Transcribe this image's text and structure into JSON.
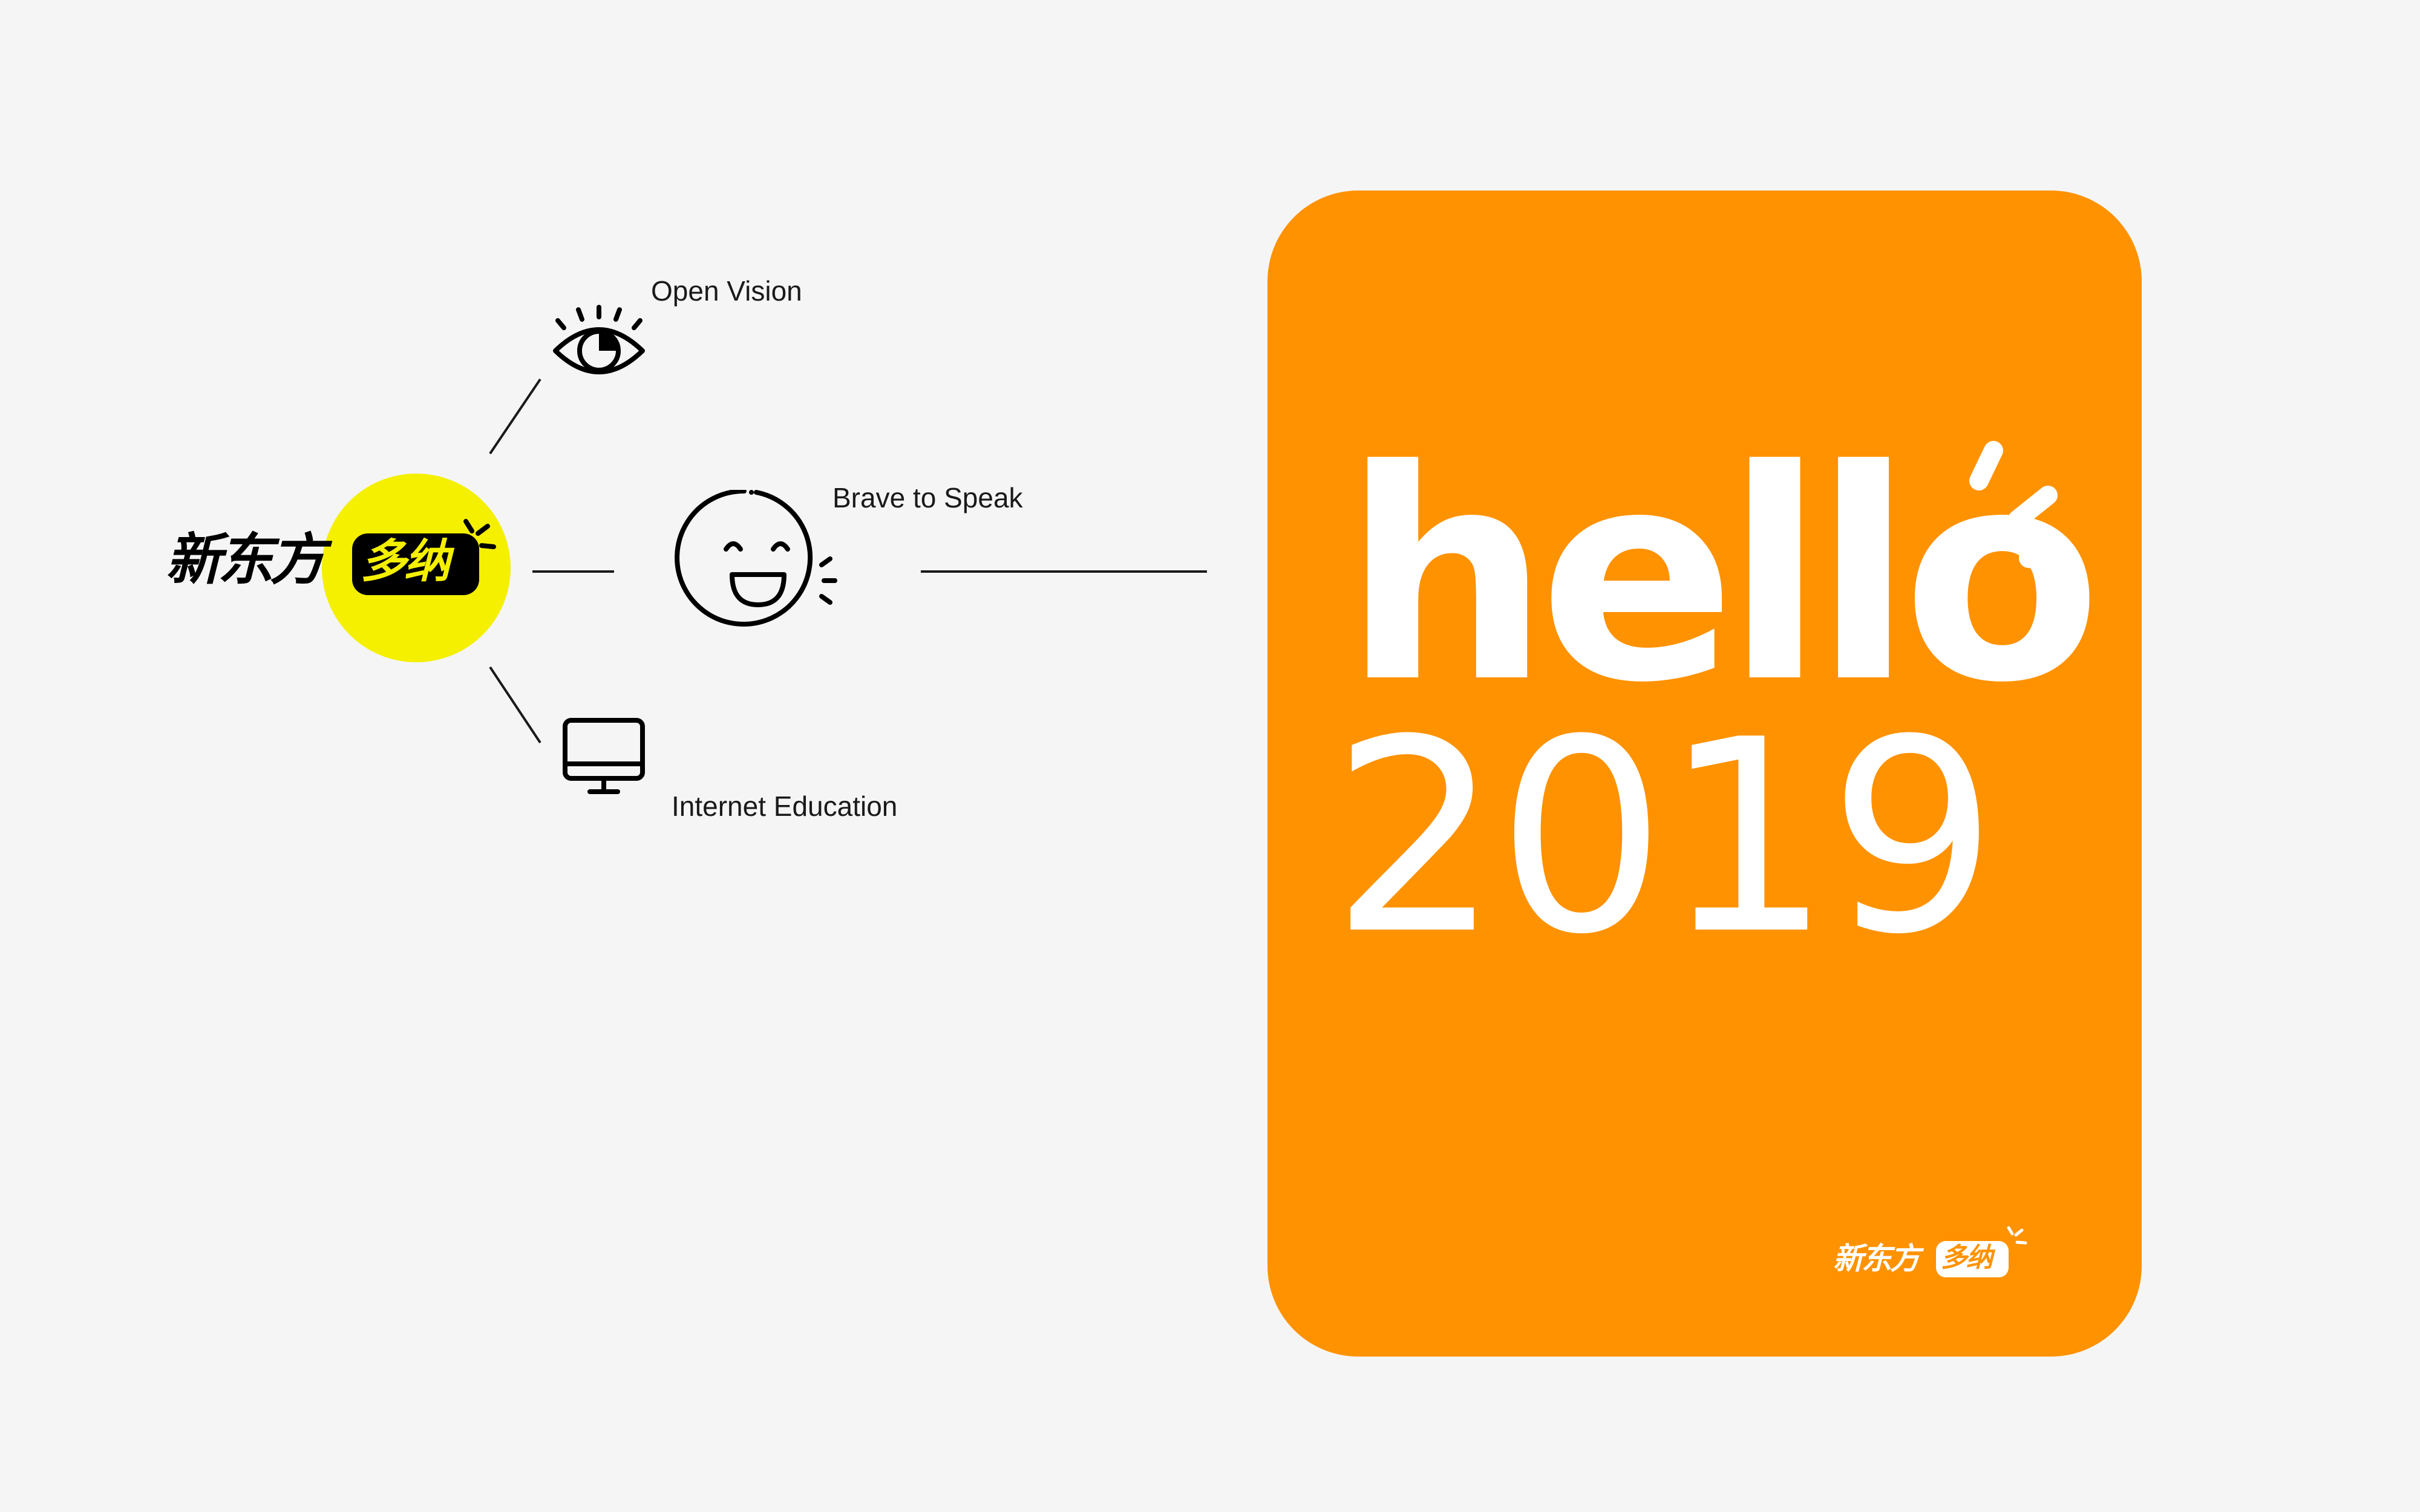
{
  "brand": {
    "name_cn": "新东方",
    "name_badge": "多纳"
  },
  "nodes": [
    {
      "id": "open-vision",
      "label": "Open Vision",
      "icon": "eye-icon"
    },
    {
      "id": "brave-to-speak",
      "label": "Brave to Speak",
      "icon": "smiling-face-icon"
    },
    {
      "id": "internet-education",
      "label": "Internet Education",
      "icon": "monitor-icon"
    }
  ],
  "card": {
    "word": "hello",
    "year": "2019"
  },
  "colors": {
    "background": "#f5f5f5",
    "card": "#ff9201",
    "logo_circle": "#f4f000",
    "ink": "#000000"
  }
}
